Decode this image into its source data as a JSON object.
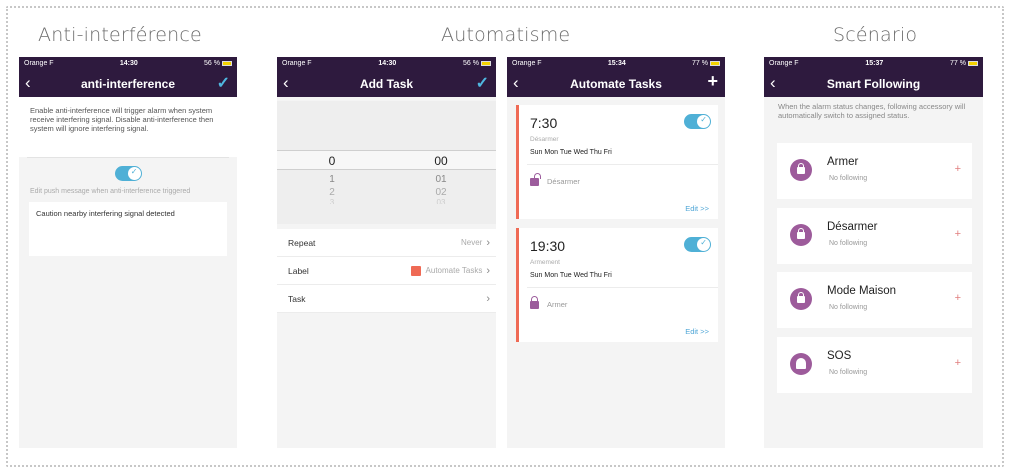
{
  "headings": {
    "anti": "Anti-interférence",
    "auto": "Automatisme",
    "scen": "Scénario"
  },
  "colors": {
    "navbar": "#2e1a3e",
    "accent_blue": "#4fb0d6",
    "accent_red": "#ef6a55",
    "purple_icon": "#9d5b9b",
    "plus_red": "#e07d7d"
  },
  "phone1": {
    "status": {
      "carrier": "Orange F",
      "time": "14:30",
      "battery": "56 %"
    },
    "title": "anti-interference",
    "back_icon": "chevron-left-icon",
    "confirm_icon": "check-icon",
    "description": "Enable anti-interference will trigger alarm when system receive interfering signal. Disable anti-interference then system will ignore interfering signal.",
    "toggle_on": true,
    "hint": "Edit push message when anti-interference triggered",
    "message": "Caution nearby interfering signal detected"
  },
  "phone2": {
    "status": {
      "carrier": "Orange F",
      "time": "14:30",
      "battery": "56 %"
    },
    "title": "Add Task",
    "back_icon": "chevron-left-icon",
    "confirm_icon": "check-icon",
    "picker": {
      "hours": [
        "0",
        "1",
        "2",
        "3"
      ],
      "minutes": [
        "00",
        "01",
        "02",
        "03"
      ]
    },
    "rows": [
      {
        "label": "Repeat",
        "value": "Never"
      },
      {
        "label": "Label",
        "value": "Automate Tasks"
      },
      {
        "label": "Task",
        "value": ""
      }
    ]
  },
  "phone3": {
    "status": {
      "carrier": "Orange F",
      "time": "15:34",
      "battery": "77 %"
    },
    "title": "Automate Tasks",
    "back_icon": "chevron-left-icon",
    "add_icon": "plus-icon",
    "tasks": [
      {
        "time": "7:30",
        "mode": "Désarmer",
        "days": "Sun Mon Tue Wed Thu Fri",
        "action": "Désarmer",
        "edit": "Edit >>",
        "enabled": true
      },
      {
        "time": "19:30",
        "mode": "Armement",
        "days": "Sun Mon Tue Wed Thu Fri",
        "action": "Armer",
        "edit": "Edit >>",
        "enabled": true
      }
    ]
  },
  "phone4": {
    "status": {
      "carrier": "Orange F",
      "time": "15:37",
      "battery": "77 %"
    },
    "title": "Smart Following",
    "back_icon": "chevron-left-icon",
    "description": "When the alarm status changes, following accessory will automatically switch to assigned status.",
    "items": [
      {
        "name": "Armer",
        "sub": "No following",
        "icon": "lock-icon"
      },
      {
        "name": "Désarmer",
        "sub": "No following",
        "icon": "unlock-icon"
      },
      {
        "name": "Mode Maison",
        "sub": "No following",
        "icon": "home-lock-icon"
      },
      {
        "name": "SOS",
        "sub": "No following",
        "icon": "bell-icon"
      }
    ],
    "plus": "+"
  }
}
